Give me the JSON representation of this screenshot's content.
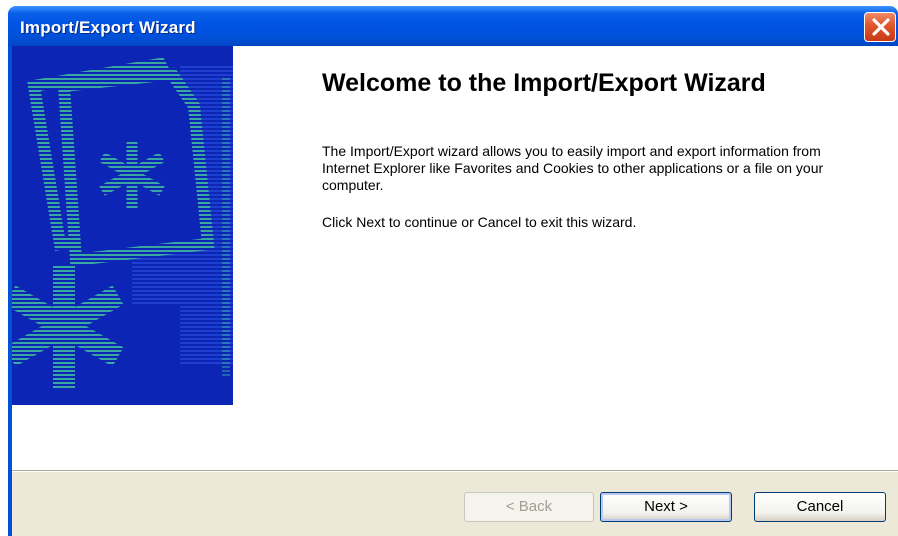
{
  "window": {
    "title": "Import/Export Wizard",
    "close_icon": "close-icon"
  },
  "banner": {
    "icon": "wizard-document-asterisk-graphic",
    "colors": {
      "background": "#0c25b5",
      "accent": "#3aa8a0"
    }
  },
  "content": {
    "heading": "Welcome to the Import/Export Wizard",
    "intro": "The Import/Export wizard allows you to easily import and export information from Internet Explorer like Favorites and Cookies to other applications or a file on your computer.",
    "instruction": "Click Next to continue or Cancel to exit this wizard."
  },
  "buttons": {
    "back": {
      "label": "< Back",
      "enabled": false
    },
    "next": {
      "label": "Next >",
      "enabled": true,
      "default": true
    },
    "cancel": {
      "label": "Cancel",
      "enabled": true
    }
  }
}
